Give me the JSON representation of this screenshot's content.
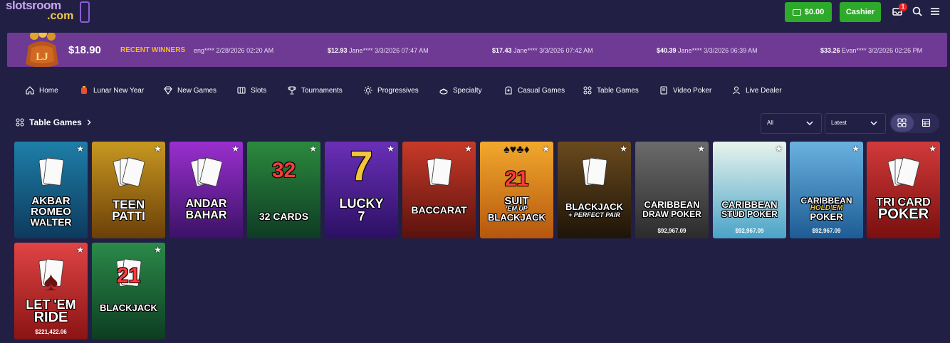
{
  "header": {
    "logo_line1": "slotsroom",
    "logo_line2": ".com",
    "balance_button": "$0.00",
    "cashier_button": "Cashier",
    "notification_count": "1",
    "icons": [
      "wallet-icon",
      "inbox-icon",
      "search-icon",
      "menu-icon"
    ]
  },
  "winners_bar": {
    "balance": "$18.90",
    "coin_text": "LJ",
    "label": "RECENT WINNERS",
    "items": [
      {
        "amount": "",
        "rest": "eng**** 2/28/2026 02:20 AM"
      },
      {
        "amount": "$12.93",
        "rest": "Jane**** 3/3/2026 07:47 AM"
      },
      {
        "amount": "$17.43",
        "rest": "Jane**** 3/3/2026 07:42 AM"
      },
      {
        "amount": "$40.39",
        "rest": "Jane**** 3/3/2026 06:39 AM"
      },
      {
        "amount": "$33.26",
        "rest": "Evan**** 3/2/2026 02:26 PM"
      }
    ]
  },
  "nav": {
    "items": [
      {
        "label": "Home",
        "icon": "home-icon"
      },
      {
        "label": "Lunar New Year",
        "icon": "lantern-icon"
      },
      {
        "label": "New Games",
        "icon": "diamond-icon"
      },
      {
        "label": "Slots",
        "icon": "slot-machine-icon"
      },
      {
        "label": "Tournaments",
        "icon": "trophy-icon"
      },
      {
        "label": "Progressives",
        "icon": "sparkle-icon"
      },
      {
        "label": "Specialty",
        "icon": "specialty-icon"
      },
      {
        "label": "Casual Games",
        "icon": "casual-icon"
      },
      {
        "label": "Table Games",
        "icon": "table-games-icon"
      },
      {
        "label": "Video Poker",
        "icon": "video-poker-icon"
      },
      {
        "label": "Live Dealer",
        "icon": "live-dealer-icon"
      }
    ]
  },
  "section": {
    "title": "Table Games",
    "filter_value": "All",
    "sort_value": "Latest"
  },
  "games": [
    {
      "t1": "AKBAR",
      "t2": "ROMEO",
      "t3": "WALTER",
      "jackpot": "",
      "colors": [
        "#1e7fa8",
        "#0d3a5e"
      ]
    },
    {
      "t1": "TEEN",
      "t2": "PATTI",
      "t3": "",
      "jackpot": "",
      "colors": [
        "#c79820",
        "#6b3f09"
      ]
    },
    {
      "t1": "ANDAR",
      "t2": "BAHAR",
      "t3": "",
      "jackpot": "",
      "colors": [
        "#9a2fcf",
        "#3b1266"
      ]
    },
    {
      "t1": "32 CARDS",
      "t2": "",
      "t3": "",
      "jackpot": "",
      "colors": [
        "#2c8a3e",
        "#0e3b24"
      ]
    },
    {
      "t1": "LUCKY",
      "t2": "7",
      "t3": "",
      "jackpot": "",
      "colors": [
        "#6a2fb8",
        "#2c1063"
      ]
    },
    {
      "t1": "BACCARAT",
      "t2": "",
      "t3": "",
      "jackpot": "",
      "colors": [
        "#c83a28",
        "#5a120d"
      ]
    },
    {
      "t1": "SUIT",
      "t2": "'EM UP",
      "t3": "BLACKJACK",
      "jackpot": "",
      "colors": [
        "#f2a92c",
        "#b5560e"
      ]
    },
    {
      "t1": "BLACKJACK",
      "t2": "+ PERFECT PAIR",
      "t3": "",
      "jackpot": "",
      "colors": [
        "#6a4a1e",
        "#1e1408"
      ]
    },
    {
      "t1": "CARIBBEAN",
      "t2": "DRAW POKER",
      "t3": "",
      "jackpot": "$92,967.09",
      "colors": [
        "#6b6b6b",
        "#2b2b2b"
      ]
    },
    {
      "t1": "CARIBBEAN",
      "t2": "STUD POKER",
      "t3": "",
      "jackpot": "$92,967.09",
      "colors": [
        "#e8f4ec",
        "#4aa3c8"
      ]
    },
    {
      "t1": "CARIBBEAN",
      "t2": "HOLD'EM",
      "t3": "POKER",
      "jackpot": "$92,967.09",
      "colors": [
        "#6ab2e0",
        "#1d5c94"
      ]
    },
    {
      "t1": "TRI CARD",
      "t2": "POKER",
      "t3": "",
      "jackpot": "",
      "colors": [
        "#d23a3a",
        "#7a0f0f"
      ]
    },
    {
      "t1": "LET 'EM",
      "t2": "RIDE",
      "t3": "",
      "jackpot": "$221,422.06",
      "colors": [
        "#e04444",
        "#8a1414"
      ]
    },
    {
      "t1": "BLACKJACK",
      "t2": "",
      "t3": "",
      "jackpot": "",
      "colors": [
        "#2b8a4a",
        "#0d3d22"
      ]
    }
  ]
}
